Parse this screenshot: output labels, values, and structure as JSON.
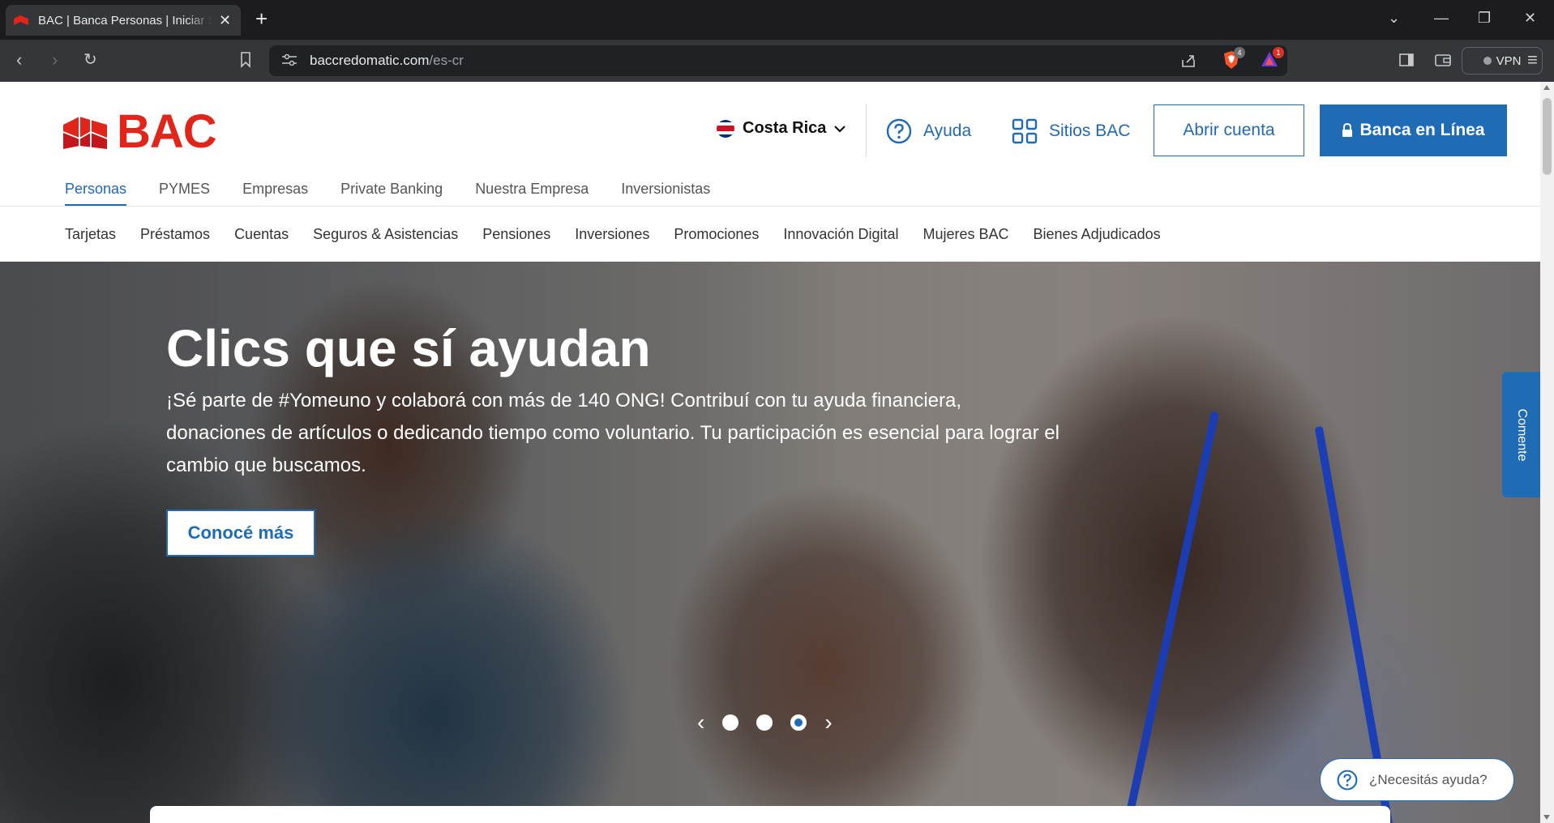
{
  "browser": {
    "tab_title": "BAC | Banca Personas | Iniciar Sesión",
    "url_domain": "baccredomatic.com",
    "url_path": "/es-cr",
    "brave_shield_count": "4",
    "rewards_count": "1",
    "vpn_label": "VPN"
  },
  "header": {
    "logo_text": "BAC",
    "country": "Costa Rica",
    "help_label": "Ayuda",
    "sites_label": "Sitios BAC",
    "open_account_label": "Abrir cuenta",
    "online_banking_label": "Banca en Línea"
  },
  "topnav": [
    "Personas",
    "PYMES",
    "Empresas",
    "Private Banking",
    "Nuestra Empresa",
    "Inversionistas"
  ],
  "topnav_active": "Personas",
  "subnav": [
    "Tarjetas",
    "Préstamos",
    "Cuentas",
    "Seguros & Asistencias",
    "Pensiones",
    "Inversiones",
    "Promociones",
    "Innovación Digital",
    "Mujeres BAC",
    "Bienes Adjudicados"
  ],
  "hero": {
    "title": "Clics que sí ayudan",
    "description": "¡Sé parte de #Yomeuno y colaborá con más de 140 ONG! Contribuí con tu ayuda financiera, donaciones de artículos o dedicando tiempo como voluntario. Tu participación es esencial para lograr el cambio que buscamos.",
    "cta_label": "Conocé más",
    "slides_total": 3,
    "active_slide": 3
  },
  "feedback_tab": "Comente",
  "help_chat": "¿Necesitás ayuda?",
  "colors": {
    "brand_red": "#e1251b",
    "brand_blue": "#1f6cb5",
    "link_blue": "#2269b3"
  }
}
